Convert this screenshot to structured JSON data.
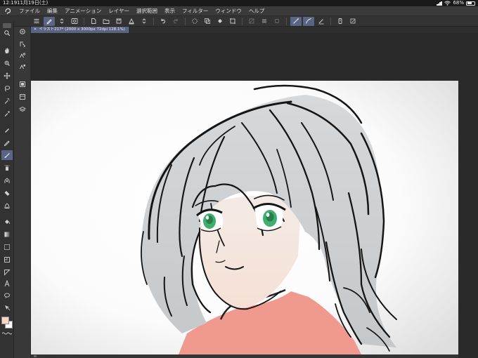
{
  "status": {
    "time": "12:19",
    "date": "11月19日(土)",
    "battery_percent": "68%",
    "battery_level": 0.68
  },
  "menu": {
    "items": [
      "ファイル",
      "編集",
      "アニメーション",
      "レイヤー",
      "選択範囲",
      "表示",
      "フィルター",
      "ウィンドウ",
      "ヘルプ"
    ]
  },
  "command_bar": {
    "buttons": [
      "menu-icon",
      "pen-icon",
      "stepper-icon",
      "gear-circle-icon",
      "new-icon",
      "open-icon",
      "save-icon",
      "undo-icon",
      "redo-icon",
      "transform-icon",
      "fill-icon",
      "select-icon",
      "stabilizer-icon",
      "ruler-icon"
    ]
  },
  "document": {
    "tab_title": "イラスト217* (2000 x 3000px 72dpi 128.1%)"
  },
  "toolbar": {
    "tools": [
      "magnifier-icon",
      "hand-icon",
      "rotate-icon",
      "move-icon",
      "lasso-icon",
      "magic-wand-icon",
      "eyedropper-icon",
      "pen-icon",
      "pencil-icon",
      "brush-icon",
      "airbrush-icon",
      "decoration-icon",
      "eraser-icon",
      "blend-icon",
      "fill-icon",
      "gradient-icon",
      "frame-icon",
      "ruler-icon",
      "text-icon",
      "balloon-icon",
      "correct-line-icon"
    ],
    "active_tool": "brush-icon",
    "foreground_color": "#f8d6c4",
    "background_color": "#ffffff"
  },
  "colors": {
    "accent": "#5a6585",
    "chrome": "#333333"
  }
}
